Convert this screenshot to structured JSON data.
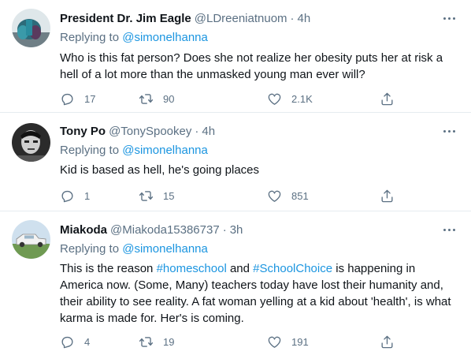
{
  "tweets": [
    {
      "name": "President Dr. Jim Eagle",
      "handle": "@LDreeniatnuom",
      "time": "4h",
      "reply_prefix": "Replying to",
      "reply_to": "@simonelhanna",
      "text": "Who is this fat person? Does she not realize her obesity puts her at risk a hell of a lot more than the unmasked young man ever will?",
      "replies": "17",
      "retweets": "90",
      "likes": "2.1K"
    },
    {
      "name": "Tony Po",
      "handle": "@TonySpookey",
      "time": "4h",
      "reply_prefix": "Replying to",
      "reply_to": "@simonelhanna",
      "text": "Kid is based as hell, he's going places",
      "replies": "1",
      "retweets": "15",
      "likes": "851"
    },
    {
      "name": "Miakoda",
      "handle": "@Miakoda15386737",
      "time": "3h",
      "reply_prefix": "Replying to",
      "reply_to": "@simonelhanna",
      "text_parts": [
        "This is the reason ",
        "#homeschool",
        " and ",
        "#SchoolChoice",
        " is happening in America now. (Some, Many) teachers today have lost their humanity and, their ability to see reality. A fat woman yelling at a kid about 'health', is what karma is made for. Her's is coming."
      ],
      "replies": "4",
      "retweets": "19",
      "likes": "191"
    }
  ],
  "separator": "·",
  "colors": {
    "link": "#1b95e0",
    "muted": "#5b7083",
    "text": "#0f1419",
    "divider": "#e6ecf0"
  },
  "icons": {
    "reply": "reply-icon",
    "retweet": "retweet-icon",
    "like": "heart-icon",
    "share": "share-icon",
    "more": "more-icon"
  }
}
